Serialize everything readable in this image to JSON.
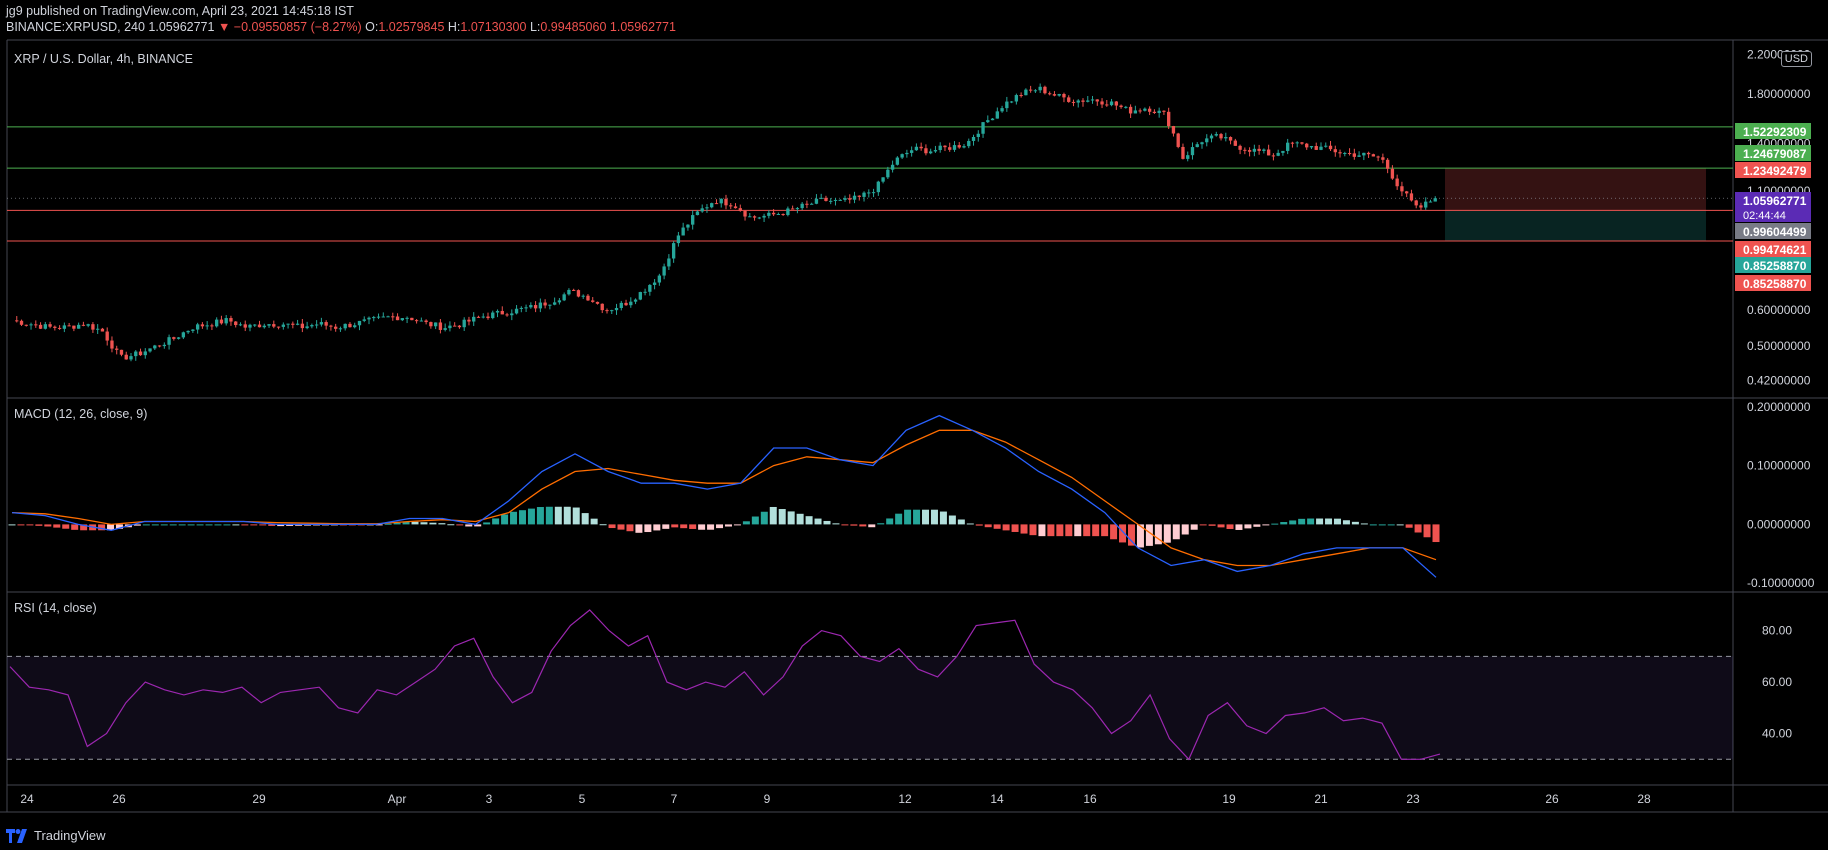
{
  "header": {
    "line1": "jg9 published on TradingView.com, April 23, 2021 14:45:18 IST",
    "symbol": "BINANCE:XRPUSD, 240",
    "last": "1.05962771",
    "change": "▼ −0.09550857 (−8.27%)",
    "o_label": "O:",
    "o": "1.02579845",
    "h_label": "H:",
    "h": "1.07130300",
    "l_label": "L:",
    "l": "0.99485060",
    "c_label": "",
    "c": "1.05962771"
  },
  "main_title": "XRP / U.S. Dollar, 4h, BINANCE",
  "currency": "USD",
  "macd_title": "MACD (12, 26, close, 9)",
  "rsi_title": "RSI (14, close)",
  "footer": {
    "brand": "TradingView",
    "icon": "tradingview-logo-icon"
  },
  "colors": {
    "up": "#26a69a",
    "down": "#ef5350",
    "macd": "#2962ff",
    "signal": "#ff6d00",
    "rsi": "#9c27b0",
    "green_line": "#4caf50",
    "red_line": "#ef5350",
    "last_price_bg": "#5b2bb5"
  },
  "chart_data": [
    {
      "type": "candlestick",
      "title": "XRP / U.S. Dollar, 4h, BINANCE",
      "y_ticks": [
        "2.20000000",
        "1.80000000",
        "1.40000000",
        "1.10000000",
        "0.80000000",
        "0.60000000",
        "0.50000000",
        "0.42000000"
      ],
      "ylim": [
        0.4,
        2.25
      ],
      "y_scale": "log",
      "x_ticks": [
        "24",
        "26",
        "29",
        "Apr",
        "3",
        "5",
        "7",
        "9",
        "12",
        "14",
        "16",
        "19",
        "21",
        "23",
        "26",
        "28"
      ],
      "horizontal_lines": [
        {
          "value": 1.52292309,
          "color": "green"
        },
        {
          "value": 1.23492479,
          "color": "green"
        },
        {
          "value": 0.99604499,
          "color": "red"
        },
        {
          "value": 0.8525887,
          "color": "red"
        }
      ],
      "price_labels": [
        {
          "text": "1.52292309",
          "bg": "#4caf50",
          "value": 1.52292309
        },
        {
          "text": "1.24679087",
          "bg": "#4caf50",
          "value": 1.24679087
        },
        {
          "text": "1.23492479",
          "bg": "#ef5350",
          "value": 1.23492479
        },
        {
          "text": "1.05962771",
          "bg": "#5b2bb5",
          "value": 1.05962771,
          "countdown": "02:44:44"
        },
        {
          "text": "0.99604499",
          "bg": "#787b86",
          "value": 0.99604499
        },
        {
          "text": "0.99474621",
          "bg": "#ef5350",
          "value": 0.99474621
        },
        {
          "text": "0.85258870",
          "bg": "#26a69a",
          "value": 0.8525887
        },
        {
          "text": "0.85258870",
          "bg": "#ef5350",
          "value": 0.8525887
        }
      ],
      "position_box": {
        "entry": 0.99604499,
        "stop": 1.23492479,
        "target": 0.8525887
      },
      "close_path": [
        0.57,
        0.56,
        0.55,
        0.55,
        0.56,
        0.54,
        0.47,
        0.48,
        0.5,
        0.52,
        0.55,
        0.56,
        0.57,
        0.55,
        0.56,
        0.56,
        0.55,
        0.56,
        0.55,
        0.56,
        0.57,
        0.58,
        0.58,
        0.56,
        0.55,
        0.56,
        0.58,
        0.59,
        0.6,
        0.61,
        0.63,
        0.66,
        0.64,
        0.6,
        0.62,
        0.66,
        0.72,
        0.88,
        0.98,
        1.05,
        1.03,
        0.96,
        0.97,
        0.99,
        1.02,
        1.05,
        1.04,
        1.06,
        1.12,
        1.28,
        1.36,
        1.35,
        1.37,
        1.4,
        1.55,
        1.7,
        1.8,
        1.85,
        1.78,
        1.74,
        1.75,
        1.72,
        1.65,
        1.68,
        1.62,
        1.3,
        1.42,
        1.45,
        1.38,
        1.35,
        1.32,
        1.4,
        1.38,
        1.36,
        1.33,
        1.32,
        1.3,
        1.12,
        1.0,
        1.06
      ]
    },
    {
      "type": "macd",
      "title": "MACD (12, 26, close, 9)",
      "y_ticks": [
        "0.20000000",
        "0.10000000",
        "0.00000000",
        "-0.10000000"
      ],
      "ylim": [
        -0.115,
        0.215
      ],
      "macd": [
        0.02,
        0.015,
        0.0,
        -0.01,
        0.005,
        0.005,
        0.005,
        0.005,
        0.0,
        0.0,
        0.0,
        0.0,
        0.01,
        0.01,
        0.0,
        0.04,
        0.09,
        0.12,
        0.09,
        0.07,
        0.07,
        0.06,
        0.07,
        0.13,
        0.13,
        0.11,
        0.1,
        0.16,
        0.185,
        0.16,
        0.13,
        0.09,
        0.06,
        0.02,
        -0.04,
        -0.07,
        -0.06,
        -0.08,
        -0.07,
        -0.05,
        -0.04,
        -0.04,
        -0.04,
        -0.09
      ],
      "signal": [
        0.02,
        0.018,
        0.01,
        0.0,
        0.005,
        0.005,
        0.005,
        0.005,
        0.003,
        0.002,
        0.001,
        0.001,
        0.005,
        0.008,
        0.005,
        0.02,
        0.06,
        0.09,
        0.095,
        0.085,
        0.075,
        0.07,
        0.07,
        0.1,
        0.115,
        0.11,
        0.105,
        0.135,
        0.16,
        0.16,
        0.14,
        0.11,
        0.08,
        0.04,
        0.0,
        -0.04,
        -0.06,
        -0.07,
        -0.07,
        -0.06,
        -0.05,
        -0.04,
        -0.04,
        -0.06
      ]
    },
    {
      "type": "rsi",
      "title": "RSI (14, close)",
      "y_ticks": [
        "80.00",
        "60.00",
        "40.00"
      ],
      "ylim": [
        20,
        95
      ],
      "bands": [
        70,
        30
      ],
      "values": [
        66,
        58,
        57,
        55,
        35,
        40,
        52,
        60,
        57,
        55,
        57,
        56,
        58,
        52,
        56,
        57,
        58,
        50,
        48,
        57,
        55,
        60,
        65,
        74,
        77,
        62,
        52,
        56,
        72,
        82,
        88,
        80,
        74,
        78,
        60,
        57,
        60,
        58,
        64,
        55,
        62,
        74,
        80,
        78,
        70,
        68,
        73,
        65,
        62,
        70,
        82,
        83,
        84,
        67,
        60,
        57,
        50,
        40,
        45,
        55,
        38,
        30,
        47,
        52,
        43,
        40,
        47,
        48,
        50,
        45,
        46,
        44,
        30,
        30,
        32
      ]
    }
  ]
}
